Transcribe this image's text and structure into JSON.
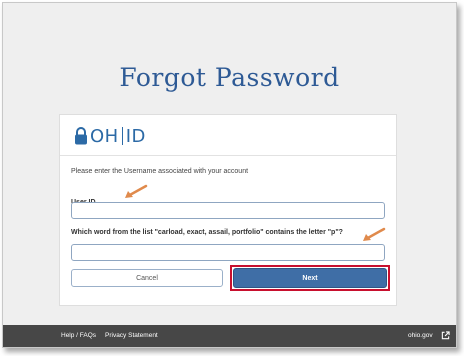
{
  "page": {
    "title": "Forgot Password"
  },
  "logo": {
    "left": "OH",
    "right": "ID",
    "icon": "lock-icon"
  },
  "form": {
    "instruction": "Please enter the Username associated with your account",
    "user_id_label": "User ID",
    "user_id_value": "",
    "question_label": "Which word from the list \"carload, exact, assail, portfolio\" contains the letter \"p\"?",
    "question_value": ""
  },
  "buttons": {
    "cancel": "Cancel",
    "next": "Next"
  },
  "footer": {
    "help": "Help / FAQs",
    "privacy": "Privacy Statement",
    "site": "ohio.gov",
    "site_icon": "external-link-icon"
  },
  "colors": {
    "title": "#2e5a95",
    "next_button": "#3f6ea6",
    "highlight": "#c8102e",
    "annotation_arrow": "#e08a4c",
    "footer": "#474747"
  }
}
